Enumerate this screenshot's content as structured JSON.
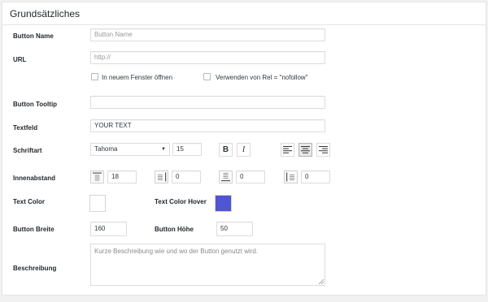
{
  "section": {
    "title": "Grundsätzliches"
  },
  "fields": {
    "button_name": {
      "label": "Button Name",
      "placeholder": "Button Name"
    },
    "url": {
      "label": "URL",
      "placeholder": "http://",
      "new_window_label": "In neuem Fenster öffnen",
      "nofollow_label": "Verwenden von Rel = \"nofollow\""
    },
    "tooltip": {
      "label": "Button Tooltip",
      "value": ""
    },
    "textfeld": {
      "label": "Textfeld",
      "value": "YOUR TEXT"
    },
    "schriftart": {
      "label": "Schriftart",
      "font": "Tahoma",
      "size": "15",
      "bold_label": "B",
      "italic_label": "I"
    },
    "innenabstand": {
      "label": "Innenabstand",
      "top": "18",
      "right": "0",
      "bottom": "0",
      "left": "0"
    },
    "text_color": {
      "label": "Text Color",
      "value": "#ffffff"
    },
    "text_color_hover": {
      "label": "Text Color Hover",
      "value": "#4f55d3"
    },
    "button_breite": {
      "label": "Button Breite",
      "value": "160"
    },
    "button_hoehe": {
      "label": "Button Höhe",
      "value": "50"
    },
    "beschreibung": {
      "label": "Beschreibung",
      "placeholder": "Kurze Beschreibung wie und wo der Button genutzt wird."
    }
  }
}
